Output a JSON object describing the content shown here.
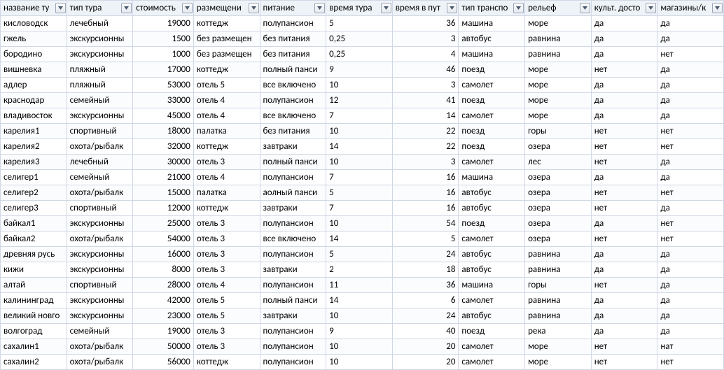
{
  "columns": [
    {
      "key": "name",
      "label": "название ту",
      "align": "left"
    },
    {
      "key": "type",
      "label": "тип тура",
      "align": "left"
    },
    {
      "key": "cost",
      "label": "стоимость",
      "align": "right"
    },
    {
      "key": "lodging",
      "label": "размещени",
      "align": "left"
    },
    {
      "key": "food",
      "label": "питание",
      "align": "left"
    },
    {
      "key": "tour_time",
      "label": "время тура",
      "align": "left"
    },
    {
      "key": "travel_time",
      "label": "время в пут",
      "align": "right"
    },
    {
      "key": "transport",
      "label": "тип транспо",
      "align": "left"
    },
    {
      "key": "relief",
      "label": "рельеф",
      "align": "left"
    },
    {
      "key": "culture",
      "label": "культ. досто",
      "align": "left"
    },
    {
      "key": "shops",
      "label": "магазины/к",
      "align": "left"
    }
  ],
  "rows": [
    {
      "name": "кисловодск",
      "type": "лечебный",
      "cost": "19000",
      "lodging": "коттедж",
      "food": "полупансион",
      "tour_time": "5",
      "travel_time": "36",
      "transport": "машина",
      "relief": "море",
      "culture": "да",
      "shops": "да"
    },
    {
      "name": "гжель",
      "type": "экскурсионны",
      "cost": "1500",
      "lodging": "без размещен",
      "food": "без питания",
      "tour_time": "0,25",
      "travel_time": "3",
      "transport": "автобус",
      "relief": "равнина",
      "culture": "да",
      "shops": "да"
    },
    {
      "name": "бородино",
      "type": "экскурсионны",
      "cost": "1000",
      "lodging": "без размещен",
      "food": "без питания",
      "tour_time": "0,25",
      "travel_time": "4",
      "transport": "машина",
      "relief": "равнина",
      "culture": "да",
      "shops": "нет"
    },
    {
      "name": "вишневка",
      "type": "пляжный",
      "cost": "17000",
      "lodging": "коттедж",
      "food": "полный панси",
      "tour_time": "9",
      "travel_time": "46",
      "transport": "поезд",
      "relief": "море",
      "culture": "нет",
      "shops": "да"
    },
    {
      "name": "адлер",
      "type": "пляжный",
      "cost": "53000",
      "lodging": "отель 5",
      "food": "все включено",
      "tour_time": "10",
      "travel_time": "3",
      "transport": "самолет",
      "relief": "море",
      "culture": "да",
      "shops": "да"
    },
    {
      "name": "краснодар",
      "type": "семейный",
      "cost": "33000",
      "lodging": "отель 4",
      "food": "полупансион",
      "tour_time": "12",
      "travel_time": "41",
      "transport": "поезд",
      "relief": "море",
      "culture": "да",
      "shops": "да"
    },
    {
      "name": "владивосток",
      "type": "экскурсионны",
      "cost": "45000",
      "lodging": "отель 4",
      "food": "все включено",
      "tour_time": "7",
      "travel_time": "14",
      "transport": "самолет",
      "relief": "море",
      "culture": "да",
      "shops": "да"
    },
    {
      "name": "карелия1",
      "type": "спортивный",
      "cost": "18000",
      "lodging": "палатка",
      "food": "без питания",
      "tour_time": "10",
      "travel_time": "22",
      "transport": "поезд",
      "relief": "горы",
      "culture": "нет",
      "shops": "нет"
    },
    {
      "name": "карелия2",
      "type": "охота/рыбалк",
      "cost": "32000",
      "lodging": "коттедж",
      "food": "завтраки",
      "tour_time": "14",
      "travel_time": "22",
      "transport": "поезд",
      "relief": "озера",
      "culture": "нет",
      "shops": "нет"
    },
    {
      "name": "карелия3",
      "type": "лечебный",
      "cost": "30000",
      "lodging": "отель 3",
      "food": "полный панси",
      "tour_time": "10",
      "travel_time": "3",
      "transport": "самолет",
      "relief": "лес",
      "culture": "нет",
      "shops": "да"
    },
    {
      "name": "селигер1",
      "type": "семейный",
      "cost": "21000",
      "lodging": "отель 4",
      "food": "полупансион",
      "tour_time": "7",
      "travel_time": "16",
      "transport": "машина",
      "relief": "озера",
      "culture": "да",
      "shops": "да"
    },
    {
      "name": "селигер2",
      "type": "охота/рыбалк",
      "cost": "15000",
      "lodging": "палатка",
      "food": "аолный панси",
      "tour_time": "5",
      "travel_time": "16",
      "transport": "автобус",
      "relief": "озера",
      "culture": "нет",
      "shops": "нет"
    },
    {
      "name": "селигер3",
      "type": "спортивный",
      "cost": "12000",
      "lodging": "коттедж",
      "food": "завтраки",
      "tour_time": "7",
      "travel_time": "16",
      "transport": "автобус",
      "relief": "озера",
      "culture": "нет",
      "shops": "да"
    },
    {
      "name": "байкал1",
      "type": "экскурсионны",
      "cost": "25000",
      "lodging": "отель 3",
      "food": "полупансион",
      "tour_time": "10",
      "travel_time": "54",
      "transport": "поезд",
      "relief": "озера",
      "culture": "да",
      "shops": "нет"
    },
    {
      "name": "байкал2",
      "type": "охота/рыбалк",
      "cost": "54000",
      "lodging": "отель 3",
      "food": "все включено",
      "tour_time": "14",
      "travel_time": "5",
      "transport": "самолет",
      "relief": "озера",
      "culture": "нет",
      "shops": "нет"
    },
    {
      "name": "древняя русь",
      "type": "экскурсионны",
      "cost": "16000",
      "lodging": "отель 3",
      "food": "полупансион",
      "tour_time": "5",
      "travel_time": "24",
      "transport": "автобус",
      "relief": "равнина",
      "culture": "да",
      "shops": "да"
    },
    {
      "name": "кижи",
      "type": "экскурсионны",
      "cost": "8000",
      "lodging": "отель 3",
      "food": "завтраки",
      "tour_time": "2",
      "travel_time": "18",
      "transport": "автобус",
      "relief": "равнина",
      "culture": "да",
      "shops": "да"
    },
    {
      "name": "алтай",
      "type": "спортивный",
      "cost": "28000",
      "lodging": "отель 4",
      "food": "полупансион",
      "tour_time": "11",
      "travel_time": "36",
      "transport": "машина",
      "relief": "горы",
      "culture": "нет",
      "shops": "да"
    },
    {
      "name": "калининград",
      "type": "экскурсионны",
      "cost": "42000",
      "lodging": "отель 5",
      "food": "полный панси",
      "tour_time": "14",
      "travel_time": "6",
      "transport": "самолет",
      "relief": "равнина",
      "culture": "да",
      "shops": "да"
    },
    {
      "name": "великий новго",
      "type": "экскурсионны",
      "cost": "23000",
      "lodging": "отель 5",
      "food": "завтраки",
      "tour_time": "10",
      "travel_time": "24",
      "transport": "автобус",
      "relief": "равнина",
      "culture": "да",
      "shops": "да"
    },
    {
      "name": "волгоград",
      "type": "семейный",
      "cost": "19000",
      "lodging": "отель 3",
      "food": "полупансион",
      "tour_time": "9",
      "travel_time": "40",
      "transport": "поезд",
      "relief": "река",
      "culture": "да",
      "shops": "да"
    },
    {
      "name": "сахалин1",
      "type": "охота/рыбалк",
      "cost": "50000",
      "lodging": "отель 3",
      "food": "полупансион",
      "tour_time": "10",
      "travel_time": "20",
      "transport": "самолет",
      "relief": "море",
      "culture": "нет",
      "shops": "нат"
    },
    {
      "name": "сахалин2",
      "type": "охота/рыбалк",
      "cost": "56000",
      "lodging": "коттедж",
      "food": "полупансион",
      "tour_time": "10",
      "travel_time": "20",
      "transport": "самолет",
      "relief": "море",
      "culture": "нет",
      "shops": "нет"
    }
  ]
}
